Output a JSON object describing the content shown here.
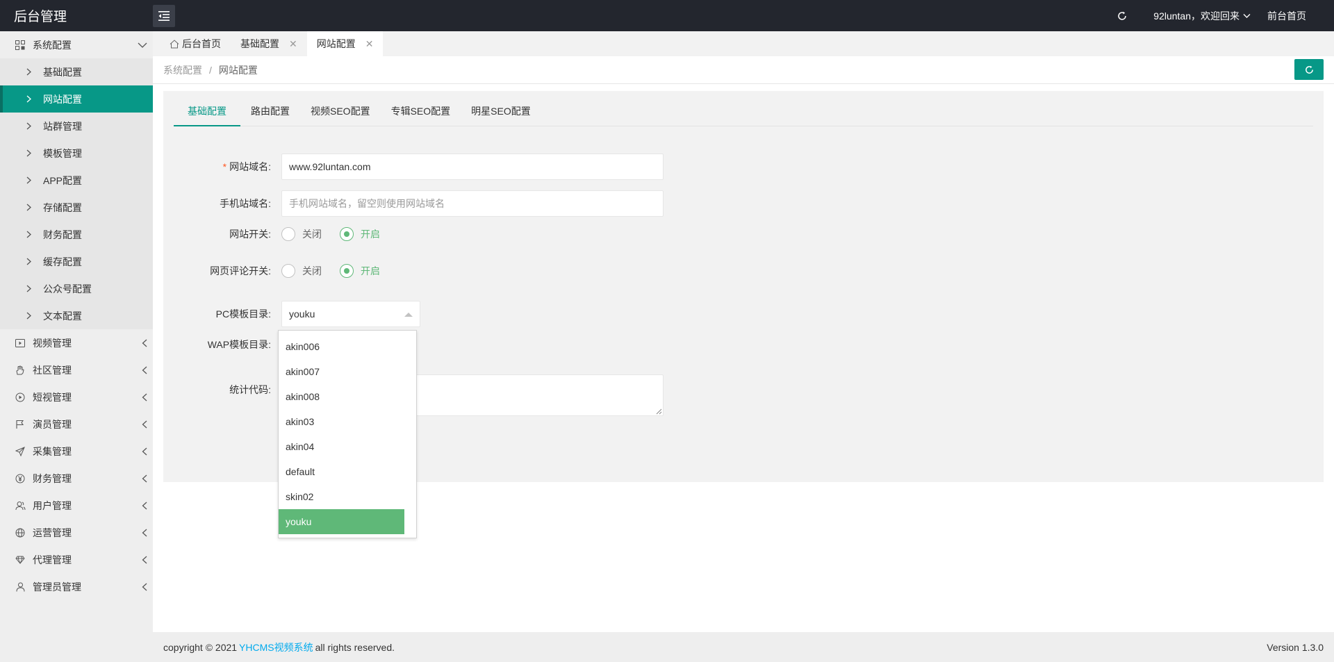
{
  "app": {
    "title": "后台管理"
  },
  "header": {
    "user_greeting": "92luntan，欢迎回来",
    "front_link": "前台首页"
  },
  "sidebar": {
    "groups": [
      {
        "label": "系统配置",
        "icon": "dashboard-icon",
        "expanded": true
      },
      {
        "label": "视频管理",
        "icon": "video-icon"
      },
      {
        "label": "社区管理",
        "icon": "hand-icon"
      },
      {
        "label": "短视管理",
        "icon": "play-circle-icon"
      },
      {
        "label": "演员管理",
        "icon": "flag-icon"
      },
      {
        "label": "采集管理",
        "icon": "send-icon"
      },
      {
        "label": "财务管理",
        "icon": "yen-icon"
      },
      {
        "label": "用户管理",
        "icon": "users-icon"
      },
      {
        "label": "运营管理",
        "icon": "globe-icon"
      },
      {
        "label": "代理管理",
        "icon": "diamond-icon"
      },
      {
        "label": "管理员管理",
        "icon": "user-icon"
      }
    ],
    "sub_items": [
      {
        "label": "基础配置"
      },
      {
        "label": "网站配置",
        "active": true
      },
      {
        "label": "站群管理"
      },
      {
        "label": "模板管理"
      },
      {
        "label": "APP配置"
      },
      {
        "label": "存储配置"
      },
      {
        "label": "财务配置"
      },
      {
        "label": "缓存配置"
      },
      {
        "label": "公众号配置"
      },
      {
        "label": "文本配置"
      }
    ]
  },
  "tabs": [
    {
      "label": "后台首页"
    },
    {
      "label": "基础配置"
    },
    {
      "label": "网站配置",
      "active": true
    }
  ],
  "breadcrumb": {
    "parent": "系统配置",
    "separator": "/",
    "current": "网站配置"
  },
  "form_tabs": [
    {
      "label": "基础配置",
      "active": true
    },
    {
      "label": "路由配置"
    },
    {
      "label": "视频SEO配置"
    },
    {
      "label": "专辑SEO配置"
    },
    {
      "label": "明星SEO配置"
    }
  ],
  "form": {
    "domain": {
      "label": "网站域名:",
      "required_mark": "*",
      "value": "www.92luntan.com"
    },
    "mobile_domain": {
      "label": "手机站域名:",
      "placeholder": "手机网站域名，留空则使用网站域名"
    },
    "site_switch": {
      "label": "网站开关:",
      "off": "关闭",
      "on": "开启",
      "selected": "开启"
    },
    "comment_switch": {
      "label": "网页评论开关:",
      "off": "关闭",
      "on": "开启",
      "selected": "开启"
    },
    "pc_template": {
      "label": "PC模板目录:",
      "value": "youku"
    },
    "wap_template": {
      "label": "WAP模板目录:"
    },
    "stats_code": {
      "label": "统计代码:"
    }
  },
  "dropdown_options": [
    "akin006",
    "akin007",
    "akin008",
    "akin03",
    "akin04",
    "default",
    "skin02",
    "youku"
  ],
  "dropdown_selected": "youku",
  "footer": {
    "copyright_prefix": "copyright © 2021",
    "brand_link": "YHCMS视频系统",
    "copyright_suffix": "all rights reserved.",
    "version": "Version 1.3.0"
  },
  "colors": {
    "accent": "#079887",
    "success": "#5fb878",
    "topbar": "#23262e",
    "link": "#01aaed"
  }
}
